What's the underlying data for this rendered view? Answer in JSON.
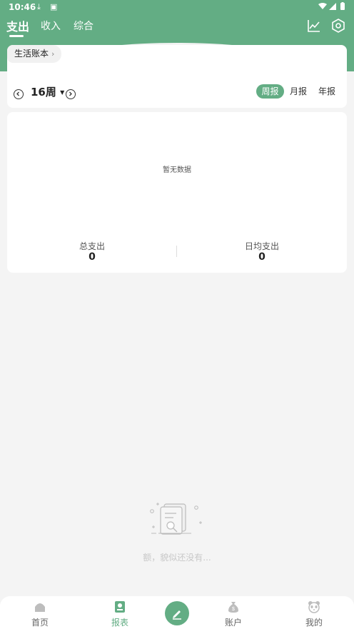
{
  "status_bar": {
    "time": "10:46"
  },
  "header": {
    "tabs": [
      {
        "label": "支出",
        "active": true
      },
      {
        "label": "收入",
        "active": false
      },
      {
        "label": "综合",
        "active": false
      }
    ],
    "icons": [
      "chart-line-icon",
      "settings-hexagon-icon"
    ]
  },
  "book": {
    "name": "生活账本"
  },
  "period": {
    "label": "16周",
    "options": [
      {
        "label": "周报",
        "active": true
      },
      {
        "label": "月报",
        "active": false
      },
      {
        "label": "年报",
        "active": false
      }
    ]
  },
  "report": {
    "no_data": "暂无数据",
    "total_label": "总支出",
    "total_value": "0",
    "daily_label": "日均支出",
    "daily_value": "0"
  },
  "empty_state": {
    "text": "额，貌似还没有..."
  },
  "bottom_nav": {
    "items": [
      {
        "label": "首页",
        "icon": "home-icon",
        "active": false
      },
      {
        "label": "报表",
        "icon": "report-book-icon",
        "active": true
      },
      {
        "label": "",
        "icon": "pencil-icon",
        "active": false
      },
      {
        "label": "账户",
        "icon": "money-bag-icon",
        "active": false
      },
      {
        "label": "我的",
        "icon": "panda-icon",
        "active": false
      }
    ]
  },
  "colors": {
    "accent": "#63ad84",
    "background": "#f4f4f4"
  }
}
